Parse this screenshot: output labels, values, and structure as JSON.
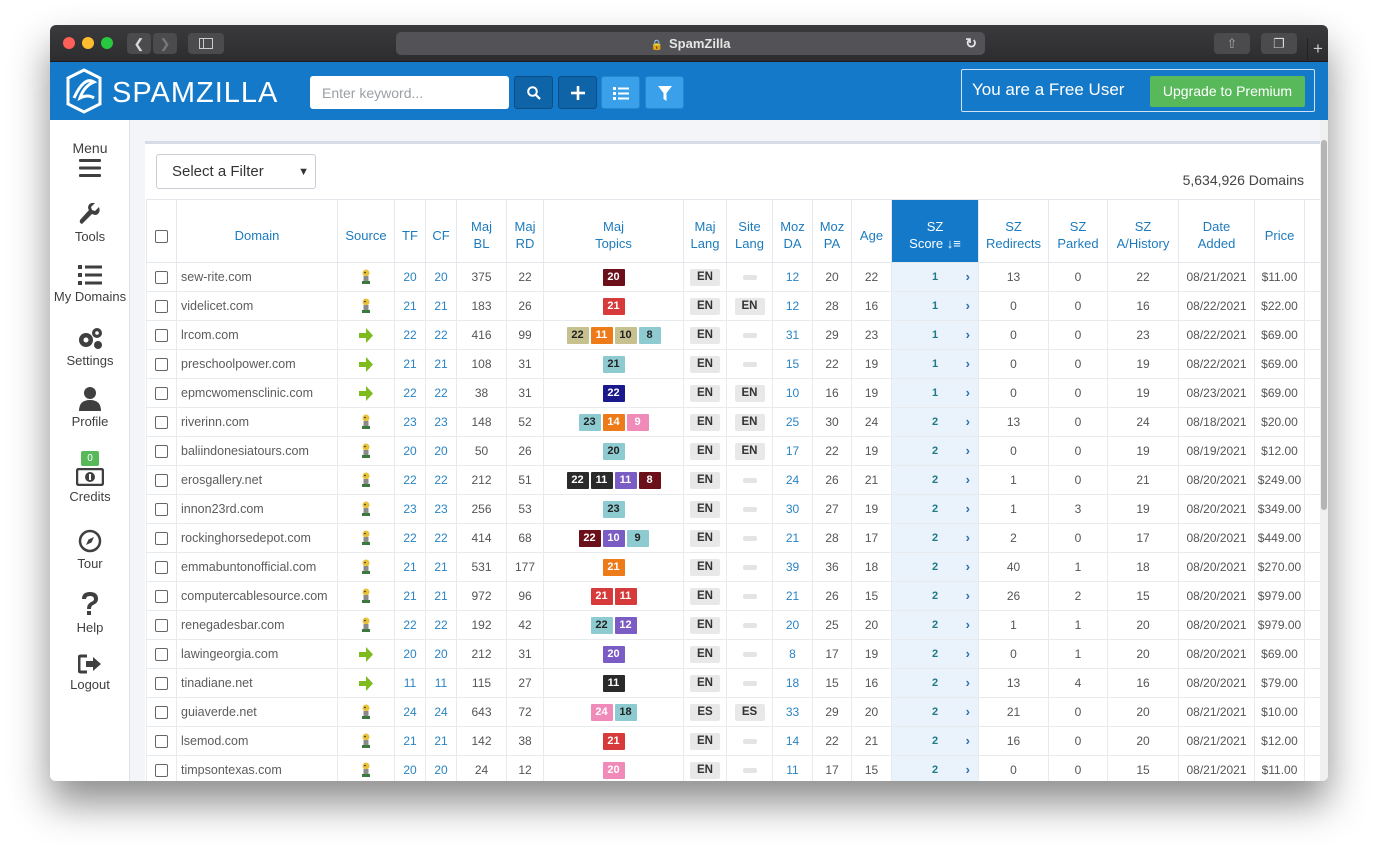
{
  "browser": {
    "title": "SpamZilla",
    "new_tab": "+"
  },
  "brand": {
    "name": "SPAMZILLA"
  },
  "search": {
    "placeholder": "Enter keyword..."
  },
  "header": {
    "free_user": "You are a Free User",
    "upgrade": "Upgrade to Premium"
  },
  "sidebar": {
    "items": [
      {
        "label": "Menu",
        "icon": "hamburger-icon"
      },
      {
        "label": "Tools",
        "icon": "wrench-icon"
      },
      {
        "label": "My Domains",
        "icon": "list-icon"
      },
      {
        "label": "Settings",
        "icon": "gears-icon"
      },
      {
        "label": "Profile",
        "icon": "user-icon"
      },
      {
        "label": "Credits",
        "icon": "money-icon",
        "badge": "0"
      },
      {
        "label": "Tour",
        "icon": "compass-icon"
      },
      {
        "label": "Help",
        "icon": "question-icon"
      },
      {
        "label": "Logout",
        "icon": "sign-out-icon"
      }
    ]
  },
  "filter": {
    "label": "Select a Filter"
  },
  "domain_count": "5,634,926 Domains",
  "table": {
    "columns": [
      "Domain",
      "Source",
      "TF",
      "CF",
      "Maj BL",
      "Maj RD",
      "Maj Topics",
      "Maj Lang",
      "Site Lang",
      "Moz DA",
      "Moz PA",
      "Age",
      "SZ Score",
      "SZ Redirects",
      "SZ Parked",
      "SZ A/History",
      "Date Added",
      "Price"
    ],
    "rows": [
      {
        "domain": "sew-rite.com",
        "source": "zilla",
        "tf": "20",
        "cf": "20",
        "bl": "375",
        "rd": "22",
        "topics": [
          [
            "20",
            "#6b0f1a",
            "w"
          ]
        ],
        "lang": "EN",
        "site": "",
        "da": "12",
        "pa": "20",
        "age": "22",
        "score": "1",
        "redir": "13",
        "parked": "0",
        "hist": "22",
        "date": "08/21/2021",
        "price": "$11.00"
      },
      {
        "domain": "videlicet.com",
        "source": "zilla",
        "tf": "21",
        "cf": "21",
        "bl": "183",
        "rd": "26",
        "topics": [
          [
            "21",
            "#d63a3a",
            "w"
          ]
        ],
        "lang": "EN",
        "site": "EN",
        "da": "12",
        "pa": "28",
        "age": "16",
        "score": "1",
        "redir": "0",
        "parked": "0",
        "hist": "16",
        "date": "08/22/2021",
        "price": "$22.00"
      },
      {
        "domain": "lrcom.com",
        "source": "arrow",
        "tf": "22",
        "cf": "22",
        "bl": "416",
        "rd": "99",
        "topics": [
          [
            "22",
            "#c6c18f",
            "d"
          ],
          [
            "11",
            "#ee7b1a",
            "w"
          ],
          [
            "10",
            "#c6c18f",
            "d"
          ],
          [
            "8",
            "#8ecbd1",
            "d"
          ]
        ],
        "lang": "EN",
        "site": "",
        "da": "31",
        "pa": "29",
        "age": "23",
        "score": "1",
        "redir": "0",
        "parked": "0",
        "hist": "23",
        "date": "08/22/2021",
        "price": "$69.00"
      },
      {
        "domain": "preschoolpower.com",
        "source": "arrow",
        "tf": "21",
        "cf": "21",
        "bl": "108",
        "rd": "31",
        "topics": [
          [
            "21",
            "#8ecbd1",
            "d"
          ]
        ],
        "lang": "EN",
        "site": "",
        "da": "15",
        "pa": "22",
        "age": "19",
        "score": "1",
        "redir": "0",
        "parked": "0",
        "hist": "19",
        "date": "08/22/2021",
        "price": "$69.00"
      },
      {
        "domain": "epmcwomensclinic.com",
        "source": "arrow",
        "tf": "22",
        "cf": "22",
        "bl": "38",
        "rd": "31",
        "topics": [
          [
            "22",
            "#1a1a8c",
            "w"
          ]
        ],
        "lang": "EN",
        "site": "EN",
        "da": "10",
        "pa": "16",
        "age": "19",
        "score": "1",
        "redir": "0",
        "parked": "0",
        "hist": "19",
        "date": "08/23/2021",
        "price": "$69.00"
      },
      {
        "domain": "riverinn.com",
        "source": "zilla",
        "tf": "23",
        "cf": "23",
        "bl": "148",
        "rd": "52",
        "topics": [
          [
            "23",
            "#8ecbd1",
            "d"
          ],
          [
            "14",
            "#ee7b1a",
            "w"
          ],
          [
            "9",
            "#f08ab8",
            "w"
          ]
        ],
        "lang": "EN",
        "site": "EN",
        "da": "25",
        "pa": "30",
        "age": "24",
        "score": "2",
        "redir": "13",
        "parked": "0",
        "hist": "24",
        "date": "08/18/2021",
        "price": "$20.00"
      },
      {
        "domain": "baliindonesiatours.com",
        "source": "zilla",
        "tf": "20",
        "cf": "20",
        "bl": "50",
        "rd": "26",
        "topics": [
          [
            "20",
            "#8ecbd1",
            "d"
          ]
        ],
        "lang": "EN",
        "site": "EN",
        "da": "17",
        "pa": "22",
        "age": "19",
        "score": "2",
        "redir": "0",
        "parked": "0",
        "hist": "19",
        "date": "08/19/2021",
        "price": "$12.00"
      },
      {
        "domain": "erosgallery.net",
        "source": "zilla",
        "tf": "22",
        "cf": "22",
        "bl": "212",
        "rd": "51",
        "topics": [
          [
            "22",
            "#2a2a2a",
            "w"
          ],
          [
            "11",
            "#2a2a2a",
            "w"
          ],
          [
            "11",
            "#7b5cc4",
            "w"
          ],
          [
            "8",
            "#6b0f1a",
            "w"
          ]
        ],
        "lang": "EN",
        "site": "",
        "da": "24",
        "pa": "26",
        "age": "21",
        "score": "2",
        "redir": "1",
        "parked": "0",
        "hist": "21",
        "date": "08/20/2021",
        "price": "$249.00"
      },
      {
        "domain": "innon23rd.com",
        "source": "zilla",
        "tf": "23",
        "cf": "23",
        "bl": "256",
        "rd": "53",
        "topics": [
          [
            "23",
            "#8ecbd1",
            "d"
          ]
        ],
        "lang": "EN",
        "site": "",
        "da": "30",
        "pa": "27",
        "age": "19",
        "score": "2",
        "redir": "1",
        "parked": "3",
        "hist": "19",
        "date": "08/20/2021",
        "price": "$349.00"
      },
      {
        "domain": "rockinghorsedepot.com",
        "source": "zilla",
        "tf": "22",
        "cf": "22",
        "bl": "414",
        "rd": "68",
        "topics": [
          [
            "22",
            "#6b0f1a",
            "w"
          ],
          [
            "10",
            "#7b5cc4",
            "w"
          ],
          [
            "9",
            "#8ecbd1",
            "d"
          ]
        ],
        "lang": "EN",
        "site": "",
        "da": "21",
        "pa": "28",
        "age": "17",
        "score": "2",
        "redir": "2",
        "parked": "0",
        "hist": "17",
        "date": "08/20/2021",
        "price": "$449.00"
      },
      {
        "domain": "emmabuntonofficial.com",
        "source": "zilla",
        "tf": "21",
        "cf": "21",
        "bl": "531",
        "rd": "177",
        "topics": [
          [
            "21",
            "#ee7b1a",
            "w"
          ]
        ],
        "lang": "EN",
        "site": "",
        "da": "39",
        "pa": "36",
        "age": "18",
        "score": "2",
        "redir": "40",
        "parked": "1",
        "hist": "18",
        "date": "08/20/2021",
        "price": "$270.00"
      },
      {
        "domain": "computercablesource.com",
        "source": "zilla",
        "tf": "21",
        "cf": "21",
        "bl": "972",
        "rd": "96",
        "topics": [
          [
            "21",
            "#d63a3a",
            "w"
          ],
          [
            "11",
            "#d63a3a",
            "w"
          ]
        ],
        "lang": "EN",
        "site": "",
        "da": "21",
        "pa": "26",
        "age": "15",
        "score": "2",
        "redir": "26",
        "parked": "2",
        "hist": "15",
        "date": "08/20/2021",
        "price": "$979.00"
      },
      {
        "domain": "renegadesbar.com",
        "source": "zilla",
        "tf": "22",
        "cf": "22",
        "bl": "192",
        "rd": "42",
        "topics": [
          [
            "22",
            "#8ecbd1",
            "d"
          ],
          [
            "12",
            "#7b5cc4",
            "w"
          ]
        ],
        "lang": "EN",
        "site": "",
        "da": "20",
        "pa": "25",
        "age": "20",
        "score": "2",
        "redir": "1",
        "parked": "1",
        "hist": "20",
        "date": "08/20/2021",
        "price": "$979.00"
      },
      {
        "domain": "lawingeorgia.com",
        "source": "arrow",
        "tf": "20",
        "cf": "20",
        "bl": "212",
        "rd": "31",
        "topics": [
          [
            "20",
            "#7b5cc4",
            "w"
          ]
        ],
        "lang": "EN",
        "site": "",
        "da": "8",
        "pa": "17",
        "age": "19",
        "score": "2",
        "redir": "0",
        "parked": "1",
        "hist": "20",
        "date": "08/20/2021",
        "price": "$69.00"
      },
      {
        "domain": "tinadiane.net",
        "source": "arrow",
        "tf": "11",
        "cf": "11",
        "bl": "115",
        "rd": "27",
        "topics": [
          [
            "11",
            "#2a2a2a",
            "w"
          ]
        ],
        "lang": "EN",
        "site": "",
        "da": "18",
        "pa": "15",
        "age": "16",
        "score": "2",
        "redir": "13",
        "parked": "4",
        "hist": "16",
        "date": "08/20/2021",
        "price": "$79.00"
      },
      {
        "domain": "guiaverde.net",
        "source": "zilla",
        "tf": "24",
        "cf": "24",
        "bl": "643",
        "rd": "72",
        "topics": [
          [
            "24",
            "#f08ab8",
            "w"
          ],
          [
            "18",
            "#8ecbd1",
            "d"
          ]
        ],
        "lang": "ES",
        "site": "ES",
        "da": "33",
        "pa": "29",
        "age": "20",
        "score": "2",
        "redir": "21",
        "parked": "0",
        "hist": "20",
        "date": "08/21/2021",
        "price": "$10.00"
      },
      {
        "domain": "lsemod.com",
        "source": "zilla",
        "tf": "21",
        "cf": "21",
        "bl": "142",
        "rd": "38",
        "topics": [
          [
            "21",
            "#d63a3a",
            "w"
          ]
        ],
        "lang": "EN",
        "site": "",
        "da": "14",
        "pa": "22",
        "age": "21",
        "score": "2",
        "redir": "16",
        "parked": "0",
        "hist": "20",
        "date": "08/21/2021",
        "price": "$12.00"
      },
      {
        "domain": "timpsontexas.com",
        "source": "zilla",
        "tf": "20",
        "cf": "20",
        "bl": "24",
        "rd": "12",
        "topics": [
          [
            "20",
            "#f08ab8",
            "w"
          ]
        ],
        "lang": "EN",
        "site": "",
        "da": "11",
        "pa": "17",
        "age": "15",
        "score": "2",
        "redir": "0",
        "parked": "0",
        "hist": "15",
        "date": "08/21/2021",
        "price": "$11.00"
      }
    ]
  }
}
